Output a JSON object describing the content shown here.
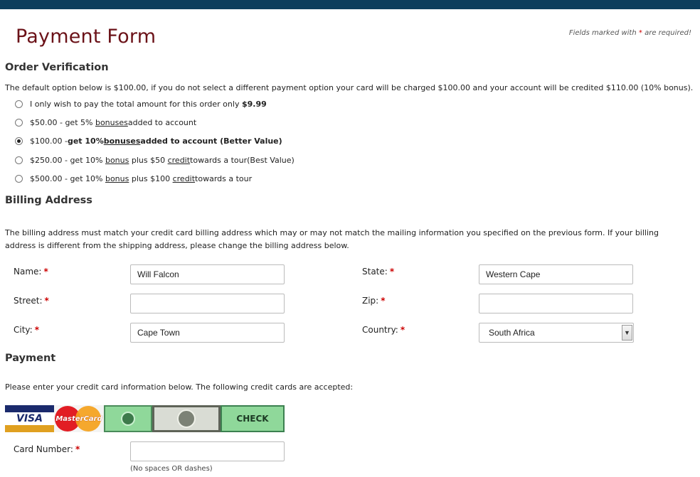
{
  "page": {
    "title": "Payment Form",
    "required_note_prefix": "Fields marked with",
    "required_star": "*",
    "required_note_suffix": "are required!"
  },
  "order": {
    "heading": "Order Verification",
    "intro": "The default option below is $100.00, if you do not select a different payment option your card will be charged $100.00 and your account will be credited $110.00 (10% bonus).",
    "options": [
      {
        "a": "I only wish to pay the total amount for this order only ",
        "b": "$9.99",
        "selected": false
      },
      {
        "a": "$50.00 - get 5% ",
        "b": "bonuses",
        "c": " added to account",
        "selected": false
      },
      {
        "a": "$100.00 - ",
        "b": "get 10% ",
        "c": "bonuses",
        "d": " added to account (Better Value)",
        "selected": true
      },
      {
        "a": "$250.00 - get 10% ",
        "b": "bonus",
        "c": " plus $50 ",
        "d": "credit",
        "e": " towards a tour(Best Value)",
        "selected": false
      },
      {
        "a": "$500.00 - get 10% ",
        "b": "bonus",
        "c": " plus $100 ",
        "d": "credit",
        "e": " towards a tour",
        "selected": false
      }
    ]
  },
  "billing": {
    "heading": "Billing Address",
    "intro": "The billing address must match your credit card billing address which may or may not match the mailing information you specified on the previous form. If your billing address is different from the shipping address, please change the billing address below.",
    "name_label": "Name:",
    "name_value": "Will Falcon",
    "street_label": "Street:",
    "street_value": "",
    "city_label": "City:",
    "city_value": "Cape Town",
    "state_label": "State:",
    "state_value": "Western Cape",
    "zip_label": "Zip:",
    "zip_value": "",
    "country_label": "Country:",
    "country_value": "South Africa",
    "star": "*"
  },
  "payment": {
    "heading": "Payment",
    "intro": "Please enter your credit card information below. The following credit cards are accepted:",
    "cards": [
      "VISA",
      "MasterCard",
      "CHECK"
    ],
    "card_number_label": "Card Number:",
    "card_number_value": "",
    "card_number_hint": "(No spaces OR dashes)",
    "star": "*"
  },
  "colors": {
    "top_bar": "#0d3e5c",
    "title": "#6b1218",
    "required_star": "#cc0000"
  }
}
